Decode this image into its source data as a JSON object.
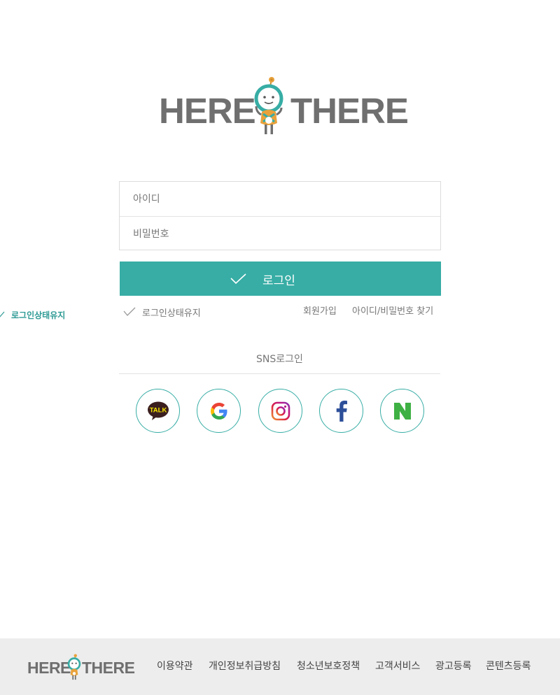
{
  "brand": {
    "left_word": "HERE",
    "right_word": "THERE"
  },
  "login_form": {
    "id_placeholder": "아이디",
    "password_placeholder": "비밀번호",
    "login_label": "로그인",
    "keep_login_label": "로그인상태유지",
    "join_link": "회원가입",
    "find_link": "아이디/비밀번호 찾기"
  },
  "sns": {
    "title": "SNS로그인",
    "providers": [
      {
        "name": "kakao",
        "icon": "kakao-talk-icon",
        "badge_text": "TALK"
      },
      {
        "name": "google",
        "icon": "google-icon",
        "badge_text": ""
      },
      {
        "name": "instagram",
        "icon": "instagram-icon",
        "badge_text": ""
      },
      {
        "name": "facebook",
        "icon": "facebook-icon",
        "badge_text": ""
      },
      {
        "name": "naver",
        "icon": "naver-icon",
        "badge_text": ""
      }
    ]
  },
  "footer": {
    "links": [
      "이용약관",
      "개인정보취급방침",
      "청소년보호정책",
      "고객서비스",
      "광고등록",
      "콘텐츠등록"
    ]
  },
  "colors": {
    "accent": "#37ada5",
    "logo_gray": "#6f6f6f",
    "footer_bg": "#ededed"
  }
}
